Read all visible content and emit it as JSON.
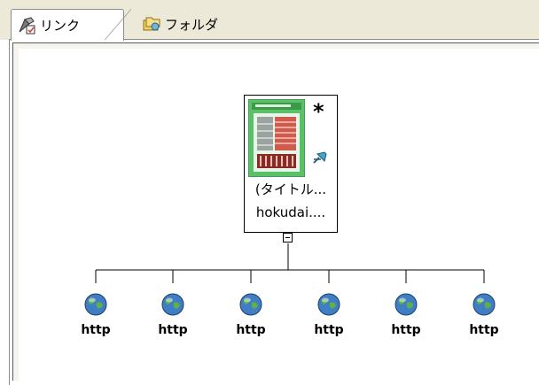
{
  "tabs": [
    {
      "label": "リンク",
      "icon": "link-icon",
      "active": true
    },
    {
      "label": "フォルダ",
      "icon": "folder-icon",
      "active": false
    }
  ],
  "root": {
    "title": "(タイトル...",
    "url": "hokudai....",
    "marker": "*",
    "thumbnail_icon": "page-thumbnail",
    "pin_icon": "pin-icon",
    "collapse_symbol": "minus"
  },
  "children": [
    {
      "label": "http",
      "icon": "globe-icon"
    },
    {
      "label": "http",
      "icon": "globe-icon"
    },
    {
      "label": "http",
      "icon": "globe-icon"
    },
    {
      "label": "http",
      "icon": "globe-icon"
    },
    {
      "label": "http",
      "icon": "globe-icon"
    },
    {
      "label": "http",
      "icon": "globe-icon"
    }
  ],
  "colors": {
    "tab_strip": "#ece9d8",
    "thumbnail_green": "#5cbf6a",
    "thumbnail_red": "#c0392b",
    "node_border": "#000000"
  }
}
